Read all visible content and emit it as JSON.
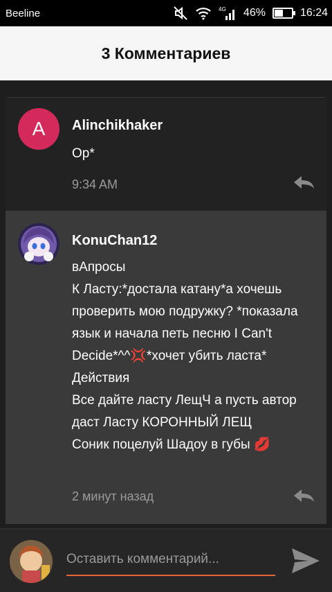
{
  "status": {
    "carrier": "Beeline",
    "network": "4G",
    "battery_text": "46%",
    "battery_level": 0.46,
    "time": "16:24"
  },
  "header": {
    "title": "3 Комментариев"
  },
  "comments": [
    {
      "avatar_letter": "A",
      "avatar_color": "#d42a5b",
      "username": "Alinchikhaker",
      "text": "Ор*",
      "time": "9:34 AM"
    },
    {
      "username": "KonuChan12",
      "text": "вАпросы\nК Ласту:*достала катану*а хочешь проверить мою подружку? *показала язык и начала петь песню I Can't Decide*^^💢*хочет убить ласта*\nДействия\nВсе дайте ласту ЛещЧ а пусть автор даст Ласту КОРОННЫЙ ЛЕЩ\nСоник поцелуй Шадоу в губы 💋",
      "time": "2 минут назад"
    }
  ],
  "input": {
    "placeholder": "Оставить комментарий...",
    "value": "",
    "accent": "#e8643a"
  }
}
